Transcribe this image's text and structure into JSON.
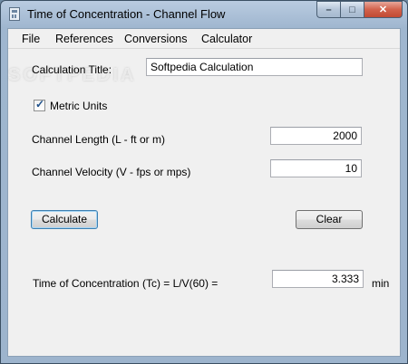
{
  "window": {
    "title": "Time of Concentration - Channel Flow",
    "minimize_glyph": "–",
    "maximize_glyph": "□",
    "close_glyph": "✕"
  },
  "menu": {
    "items": [
      "File",
      "References",
      "Conversions",
      "Calculator"
    ]
  },
  "form": {
    "calc_title_label": "Calculation Title:",
    "calc_title_value": "Softpedia Calculation",
    "metric_label": "Metric Units",
    "metric_checked": true,
    "length_label": "Channel Length (L - ft or m)",
    "length_value": "2000",
    "velocity_label": "Channel Velocity (V - fps or mps)",
    "velocity_value": "10",
    "calculate_label": "Calculate",
    "clear_label": "Clear",
    "result_label": "Time of Concentration (Tc)  = L/V(60) =",
    "result_value": "3.333",
    "result_unit": "min"
  },
  "watermark": "SOFTPEDIA",
  "colors": {
    "frame": "#9db4cd",
    "client_bg": "#f0f0f0",
    "close_button": "#c24a32",
    "default_button_border": "#3c7fb1"
  },
  "icons": [
    "app-calculator-icon",
    "minimize-icon",
    "maximize-icon",
    "close-icon",
    "check-icon"
  ]
}
